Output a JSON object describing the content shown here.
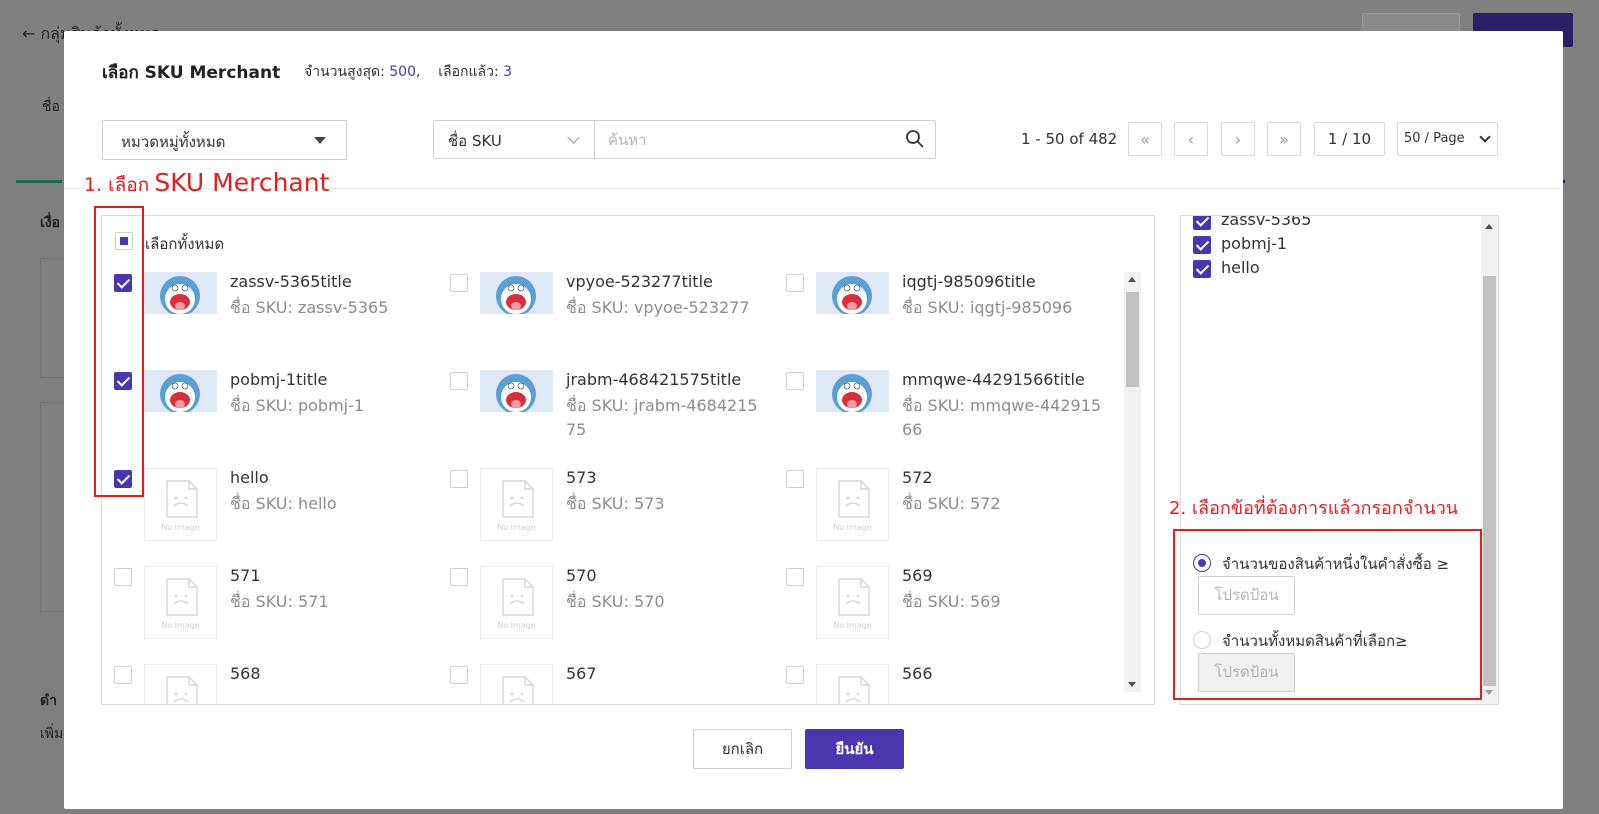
{
  "background": {
    "back_label": "← กลุ่มสินค้าทั้งหมด",
    "label_1": "ชื่อ",
    "label_2": "เงื่อ",
    "label_3": "ดำ",
    "label_4": "เพิ่ม"
  },
  "modal": {
    "title": "เลือก SKU Merchant",
    "max_label": "จำนวนสูงสุด:",
    "max_value": "500",
    "selected_label": "เลือกแล้ว:",
    "selected_value": "3"
  },
  "filters": {
    "category": "หมวดหมู่ทั้งหมด",
    "search_field": "ชื่อ SKU",
    "search_placeholder": "ค้นหา"
  },
  "pagination": {
    "range": "1 - 50 of 482",
    "current": "1 / 10",
    "page_size": "50 / Page"
  },
  "list": {
    "select_all": "เลือกทั้งหมด",
    "items": [
      {
        "title": "zassv-5365title",
        "sku": "ชื่อ SKU: zassv-5365",
        "checked": true,
        "has_image": true
      },
      {
        "title": "vpyoe-523277title",
        "sku": "ชื่อ SKU: vpyoe-523277",
        "checked": false,
        "has_image": true
      },
      {
        "title": "iqgtj-985096title",
        "sku": "ชื่อ SKU: iqgtj-985096",
        "checked": false,
        "has_image": true
      },
      {
        "title": "pobmj-1title",
        "sku": "ชื่อ SKU: pobmj-1",
        "checked": true,
        "has_image": true
      },
      {
        "title": "jrabm-468421575title",
        "sku": "ชื่อ SKU: jrabm-468421575",
        "checked": false,
        "has_image": true
      },
      {
        "title": "mmqwe-44291566title",
        "sku": "ชื่อ SKU: mmqwe-44291566",
        "checked": false,
        "has_image": true
      },
      {
        "title": "hello",
        "sku": "ชื่อ SKU: hello",
        "checked": true,
        "has_image": false
      },
      {
        "title": "573",
        "sku": "ชื่อ SKU: 573",
        "checked": false,
        "has_image": false
      },
      {
        "title": "572",
        "sku": "ชื่อ SKU: 572",
        "checked": false,
        "has_image": false
      },
      {
        "title": "571",
        "sku": "ชื่อ SKU: 571",
        "checked": false,
        "has_image": false
      },
      {
        "title": "570",
        "sku": "ชื่อ SKU: 570",
        "checked": false,
        "has_image": false
      },
      {
        "title": "569",
        "sku": "ชื่อ SKU: 569",
        "checked": false,
        "has_image": false
      },
      {
        "title": "568",
        "sku": "",
        "checked": false,
        "has_image": false
      },
      {
        "title": "567",
        "sku": "",
        "checked": false,
        "has_image": false
      },
      {
        "title": "566",
        "sku": "",
        "checked": false,
        "has_image": false
      }
    ],
    "no_image_label": "No Image"
  },
  "selected_panel": {
    "items": [
      "zassv-5365",
      "pobmj-1",
      "hello"
    ],
    "option_1": "จำนวนของสินค้าหนึ่งในคำสั่งซื้อ ≥",
    "option_2": "จำนวนทั้งหมดสินค้าที่เลือก≥",
    "input_placeholder": "โปรดป้อน"
  },
  "footer": {
    "cancel": "ยกเลิก",
    "confirm": "ยืนยัน"
  },
  "annotations": {
    "step1_prefix": "1. เลือก",
    "step1_suffix": "SKU Merchant",
    "step2": "2. เลือกข้อที่ต้องการแล้วกรอกจำนวน"
  },
  "colors": {
    "accent": "#4b36b0",
    "annotation": "#e02020"
  }
}
